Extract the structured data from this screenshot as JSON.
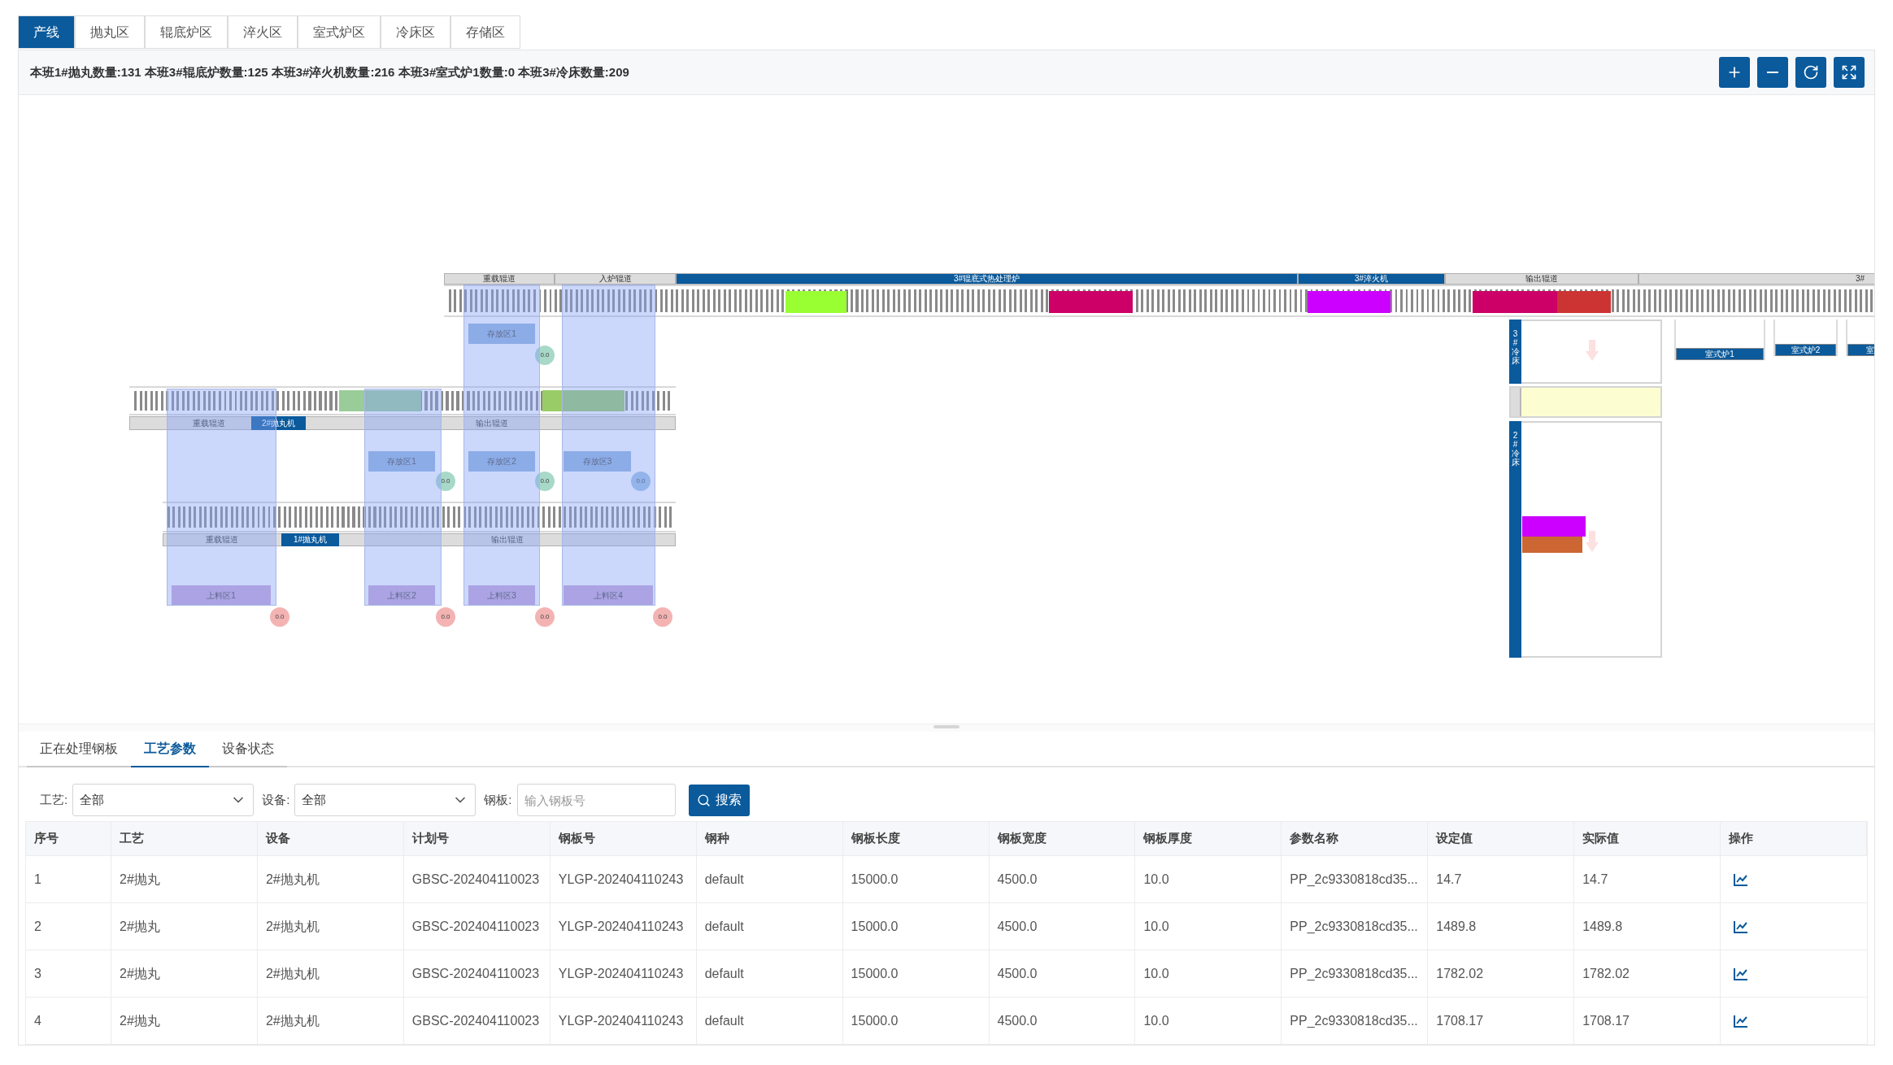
{
  "tabs": [
    {
      "label": "产线",
      "selected": true
    },
    {
      "label": "抛丸区",
      "selected": false
    },
    {
      "label": "辊底炉区",
      "selected": false
    },
    {
      "label": "淬火区",
      "selected": false
    },
    {
      "label": "室式炉区",
      "selected": false
    },
    {
      "label": "冷床区",
      "selected": false
    },
    {
      "label": "存储区",
      "selected": false
    }
  ],
  "summary": "本班1#抛丸数量:131 本班3#辊底炉数量:125 本班3#淬火机数量:216 本班3#室式炉1数量:0 本班3#冷床数量:209",
  "toolbar": [
    {
      "kind": "zoom_in"
    },
    {
      "kind": "zoom_out"
    },
    {
      "kind": "reset"
    },
    {
      "kind": "fullscreen"
    }
  ],
  "diagram": {
    "lines": [
      {
        "segments": [
          {
            "label": "重载辊道",
            "kind": "track"
          },
          {
            "label": "入炉辊道",
            "kind": "track"
          },
          {
            "label": "3#辊底式热处理炉",
            "kind": "machine"
          },
          {
            "label": "3#淬火机",
            "kind": "machine"
          },
          {
            "label": "输出辊道",
            "kind": "track"
          },
          {
            "label": "3#",
            "kind": "track"
          }
        ],
        "slabs": [
          {
            "color": "#99ff33"
          },
          {
            "color": "#cc0066"
          },
          {
            "color": "#cc00ff"
          },
          {
            "color": "#cc0066"
          },
          {
            "color": "#cc3333"
          }
        ]
      },
      {
        "segments": [
          {
            "label": "重载辊道",
            "kind": "track"
          },
          {
            "label": "2#抛丸机",
            "kind": "machine"
          },
          {
            "label": "输出辊道",
            "kind": "track"
          }
        ],
        "slabs": [
          {
            "color": "#99cc99"
          },
          {
            "color": "#99cc66"
          }
        ]
      },
      {
        "segments": [
          {
            "label": "重载辊道",
            "kind": "track"
          },
          {
            "label": "1#抛丸机",
            "kind": "machine"
          },
          {
            "label": "输出辊道",
            "kind": "track"
          }
        ]
      }
    ],
    "zones": [
      {
        "label": "存放区1",
        "kind": "storage",
        "value": "0.0",
        "color": "#a8d9c8"
      },
      {
        "label": "存放区1",
        "kind": "storage",
        "value": "0.0",
        "color": "#a8d9c8"
      },
      {
        "label": "存放区2",
        "kind": "storage",
        "value": "0.0",
        "color": "#a8d9c8"
      },
      {
        "label": "存放区3",
        "kind": "storage",
        "value": "0.0",
        "color": "#9fc3e3"
      },
      {
        "label": "上料区1",
        "kind": "loading",
        "value": "0.0",
        "color": "#f4b3b3"
      },
      {
        "label": "上料区2",
        "kind": "loading",
        "value": "0.0",
        "color": "#f4b3b3"
      },
      {
        "label": "上料区3",
        "kind": "loading",
        "value": "0.0",
        "color": "#f4b3b3"
      },
      {
        "label": "上料区4",
        "kind": "loading",
        "value": "0.0",
        "color": "#f4b3b3"
      }
    ],
    "cold_beds": [
      {
        "label": "3#冷床"
      },
      {
        "label": "2#冷床",
        "slabs": [
          {
            "color": "#cc00ff"
          },
          {
            "color": "#cc6633"
          }
        ]
      }
    ],
    "chamber_furnaces": [
      {
        "label": "室式炉1"
      },
      {
        "label": "室式炉2"
      },
      {
        "label": "室"
      }
    ]
  },
  "bottom_tabs": [
    {
      "label": "正在处理钢板",
      "selected": false
    },
    {
      "label": "工艺参数",
      "selected": true
    },
    {
      "label": "设备状态",
      "selected": false
    }
  ],
  "filters": [
    {
      "label": "工艺:",
      "kind": "select",
      "value": "全部"
    },
    {
      "label": "设备:",
      "kind": "select",
      "value": "全部"
    },
    {
      "label": "钢板:",
      "kind": "input",
      "placeholder": "输入钢板号"
    }
  ],
  "search_button": "搜索",
  "table": {
    "columns": [
      "序号",
      "工艺",
      "设备",
      "计划号",
      "钢板号",
      "钢种",
      "钢板长度",
      "钢板宽度",
      "钢板厚度",
      "参数名称",
      "设定值",
      "实际值",
      "操作"
    ],
    "rows": [
      [
        "1",
        "2#抛丸",
        "2#抛丸机",
        "GBSC-202404110023",
        "YLGP-202404110243",
        "default",
        "15000.0",
        "4500.0",
        "10.0",
        "PP_2c9330818cd35...",
        "14.7",
        "14.7"
      ],
      [
        "2",
        "2#抛丸",
        "2#抛丸机",
        "GBSC-202404110023",
        "YLGP-202404110243",
        "default",
        "15000.0",
        "4500.0",
        "10.0",
        "PP_2c9330818cd35...",
        "1489.8",
        "1489.8"
      ],
      [
        "3",
        "2#抛丸",
        "2#抛丸机",
        "GBSC-202404110023",
        "YLGP-202404110243",
        "default",
        "15000.0",
        "4500.0",
        "10.0",
        "PP_2c9330818cd35...",
        "1782.02",
        "1782.02"
      ],
      [
        "4",
        "2#抛丸",
        "2#抛丸机",
        "GBSC-202404110023",
        "YLGP-202404110243",
        "default",
        "15000.0",
        "4500.0",
        "10.0",
        "PP_2c9330818cd35...",
        "1708.17",
        "1708.17"
      ]
    ]
  }
}
